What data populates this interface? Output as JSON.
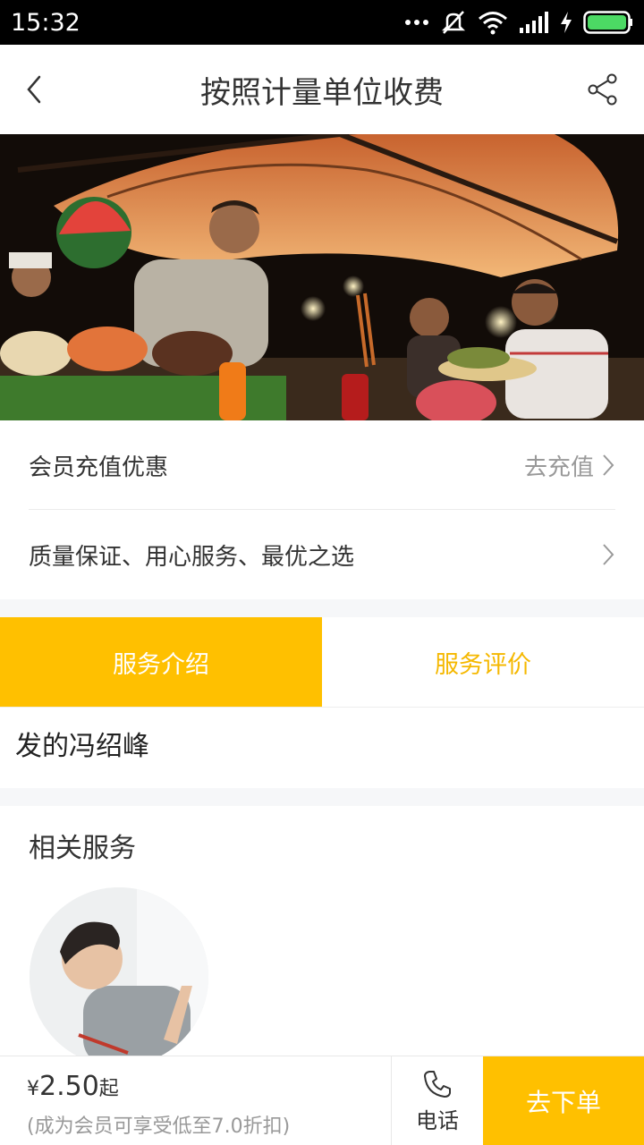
{
  "status_bar": {
    "time": "15:32",
    "battery_color": "#4cd964"
  },
  "header": {
    "title": "按照计量单位收费",
    "back_icon": "chevron-left-icon",
    "share_icon": "share-icon"
  },
  "hero": {
    "image": "night-market-food-stall-photo"
  },
  "rows": [
    {
      "label": "会员充值优惠",
      "action": "去充值"
    },
    {
      "label": "质量保证、用心服务、最优之选",
      "action": ""
    }
  ],
  "tabs": [
    {
      "label": "服务介绍",
      "active": true
    },
    {
      "label": "服务评价",
      "active": false
    }
  ],
  "intro": {
    "text": "发的冯绍峰"
  },
  "related": {
    "title": "相关服务"
  },
  "bottom_bar": {
    "currency": "¥",
    "price": "2.50",
    "price_suffix": "起",
    "member_note": "(成为会员可享受低至7.0折扣)",
    "phone_label": "电话",
    "order_label": "去下单"
  },
  "colors": {
    "accent": "#ffc000",
    "accent_text": "#f5b800",
    "status_bar": "#000000"
  }
}
